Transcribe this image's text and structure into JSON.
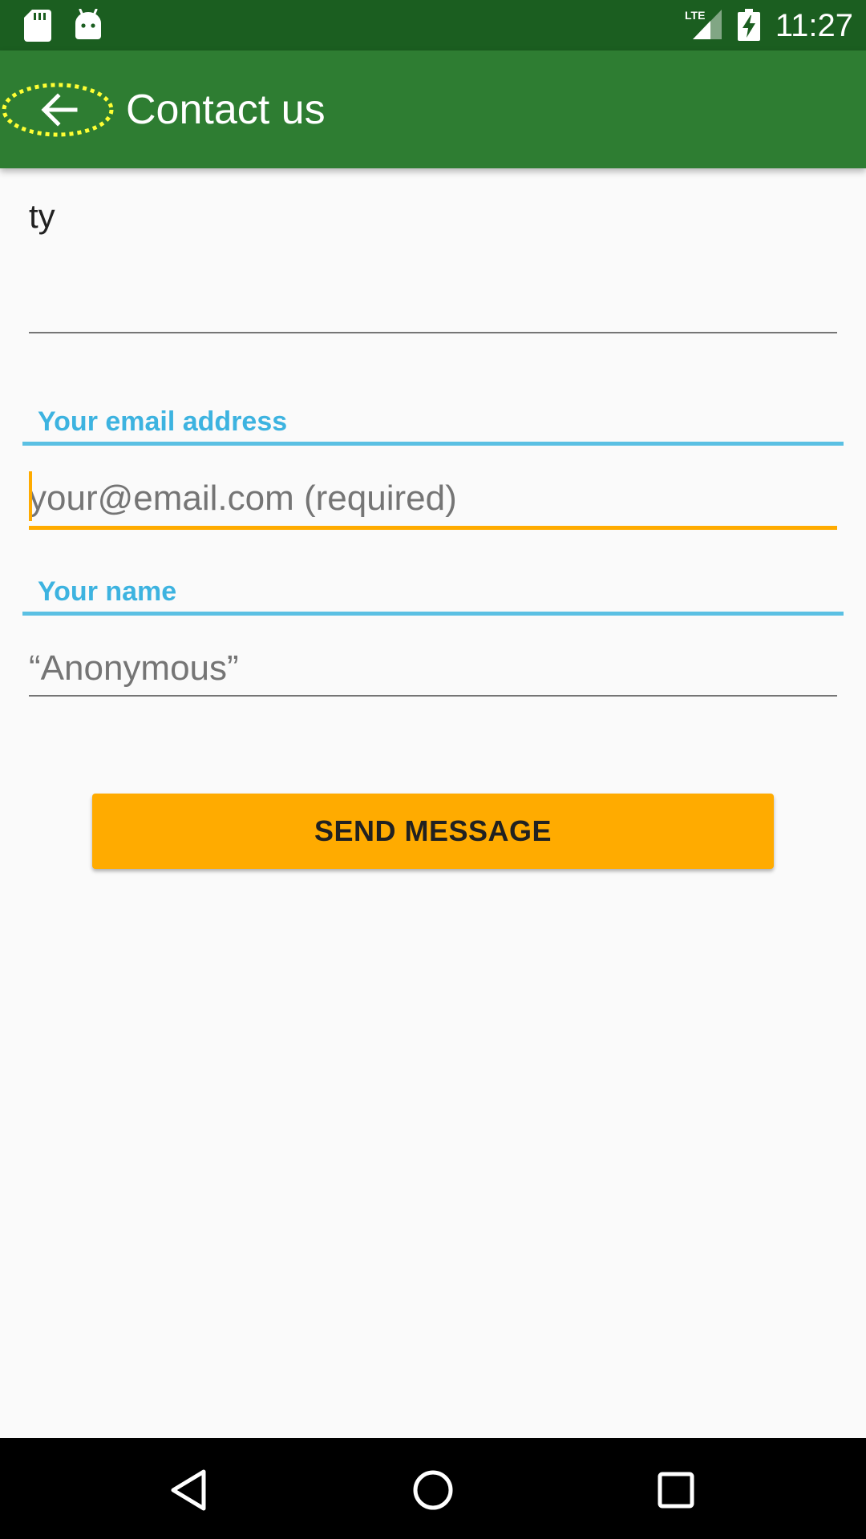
{
  "status_bar": {
    "time": "11:27",
    "network": "LTE",
    "icons": [
      "sd-card-icon",
      "android-icon",
      "lte-signal-icon",
      "battery-charging-icon"
    ]
  },
  "app_bar": {
    "title": "Contact us",
    "back_icon": "arrow-back-icon"
  },
  "form": {
    "message_value": "ty",
    "email_label": "Your email address",
    "email_placeholder": "your@email.com (required)",
    "email_value": "",
    "name_label": "Your name",
    "name_placeholder": "“Anonymous”",
    "name_value": "",
    "send_label": "SEND MESSAGE"
  },
  "nav_bar": {
    "icons": [
      "nav-back-icon",
      "nav-home-icon",
      "nav-recents-icon"
    ]
  },
  "colors": {
    "status_bar": "#1b5e20",
    "app_bar": "#2e7d32",
    "accent": "#ffab00",
    "label": "#3db3e0"
  }
}
